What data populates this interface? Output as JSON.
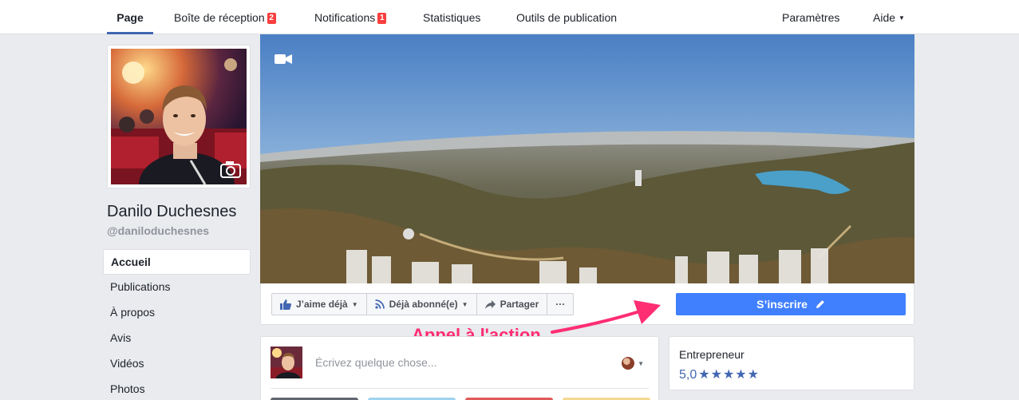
{
  "nav": {
    "items": [
      {
        "label": "Page"
      },
      {
        "label": "Boîte de réception",
        "badge": "2"
      },
      {
        "label": "Notifications",
        "badge": "1"
      },
      {
        "label": "Statistiques"
      },
      {
        "label": "Outils de publication"
      }
    ],
    "settings": "Paramètres",
    "help": "Aide"
  },
  "profile": {
    "name": "Danilo Duchesnes",
    "handle": "@daniloduchesnes"
  },
  "sidebar": {
    "items": [
      {
        "label": "Accueil",
        "active": true
      },
      {
        "label": "Publications"
      },
      {
        "label": "À propos"
      },
      {
        "label": "Avis"
      },
      {
        "label": "Vidéos"
      },
      {
        "label": "Photos"
      }
    ]
  },
  "actions": {
    "like": "J’aime déjà",
    "follow": "Déjà abonné(e)",
    "share": "Partager",
    "more": "···",
    "cta": "S’inscrire"
  },
  "annotation": "Appel à l'action",
  "composer": {
    "placeholder": "Écrivez quelque chose..."
  },
  "info": {
    "category": "Entrepreneur",
    "rating": "5,0",
    "stars": "★★★★★"
  },
  "colors": {
    "brand": "#4267b2",
    "cta": "#4080ff",
    "annotation": "#ff2d72",
    "badge": "#fa3e3e"
  }
}
